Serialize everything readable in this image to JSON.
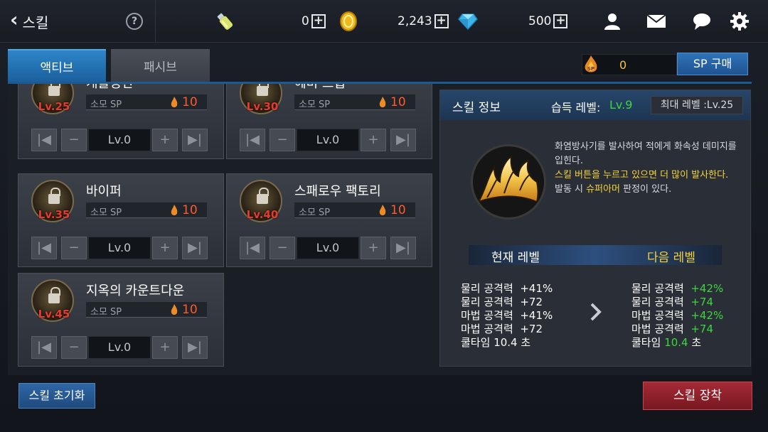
{
  "header": {
    "back_label": "스킬",
    "help_symbol": "?",
    "currencies": [
      {
        "icon": "potion-icon",
        "value": "0"
      },
      {
        "icon": "gold-coin-icon",
        "value": "2,243"
      },
      {
        "icon": "diamond-icon",
        "value": "500"
      }
    ],
    "plus_symbol": "+",
    "icons": [
      "friends-icon",
      "mail-icon",
      "chat-icon",
      "gear-icon"
    ]
  },
  "tabs": [
    {
      "label": "액티브",
      "active": true
    },
    {
      "label": "패시브",
      "active": false
    }
  ],
  "sp": {
    "icon": "sp-flame-icon",
    "icon_text": "SP",
    "value": "0",
    "buy_label": "SP 구매"
  },
  "skills": [
    {
      "name": "개틀링건",
      "level_req": "Lv.25",
      "cost_label": "소모 SP",
      "cost": "10",
      "level": "Lv.0"
    },
    {
      "name": "헤비 스윕",
      "level_req": "Lv.30",
      "cost_label": "소모 SP",
      "cost": "10",
      "level": "Lv.0"
    },
    {
      "name": "바이퍼",
      "level_req": "Lv.35",
      "cost_label": "소모 SP",
      "cost": "10",
      "level": "Lv.0"
    },
    {
      "name": "스패로우 팩토리",
      "level_req": "Lv.40",
      "cost_label": "소모 SP",
      "cost": "10",
      "level": "Lv.0"
    },
    {
      "name": "지옥의 카운트다운",
      "level_req": "Lv.45",
      "cost_label": "소모 SP",
      "cost": "10",
      "level": "Lv.0"
    }
  ],
  "control_symbols": {
    "first": "|◀",
    "minus": "−",
    "plus": "+",
    "last": "▶|"
  },
  "info": {
    "title": "스킬 정보",
    "acquire_label": "습득 레벨:",
    "acquire_value": "Lv.9",
    "max_level": "최대 레벨 :Lv.25",
    "desc_line1": "화염방사기를 발사하여 적에게 화속성 데미지를 입힌다.",
    "desc_line2": "스킬 버튼을 누르고 있으면 더 많이 발사한다.",
    "desc_line3_a": "발동 시 ",
    "desc_line3_b": "슈퍼아머",
    "desc_line3_c": " 판정이 있다.",
    "current_label": "현재 레벨",
    "next_label": "다음 레벨",
    "current_stats": [
      {
        "name": "물리 공격력",
        "value": "+41%"
      },
      {
        "name": "물리 공격력",
        "value": "+72"
      },
      {
        "name": "마법 공격력",
        "value": "+41%"
      },
      {
        "name": "마법 공격력",
        "value": "+72"
      },
      {
        "name": "쿨타임",
        "value": "10.4 초"
      }
    ],
    "next_stats": [
      {
        "name": "물리 공격력",
        "value": "+42%"
      },
      {
        "name": "물리 공격력",
        "value": "+74"
      },
      {
        "name": "마법 공격력",
        "value": "+42%"
      },
      {
        "name": "마법 공격력",
        "value": "+74"
      },
      {
        "name": "쿨타임",
        "value": "10.4",
        "unit": "초"
      }
    ]
  },
  "buttons": {
    "reset": "스킬 초기화",
    "equip": "스킬 장착"
  },
  "colors": {
    "accent_blue": "#2d86c9",
    "equip_red": "#a52a35",
    "cost_orange": "#ff5a2a",
    "green": "#3ed63e",
    "yellow": "#f3d23a"
  }
}
